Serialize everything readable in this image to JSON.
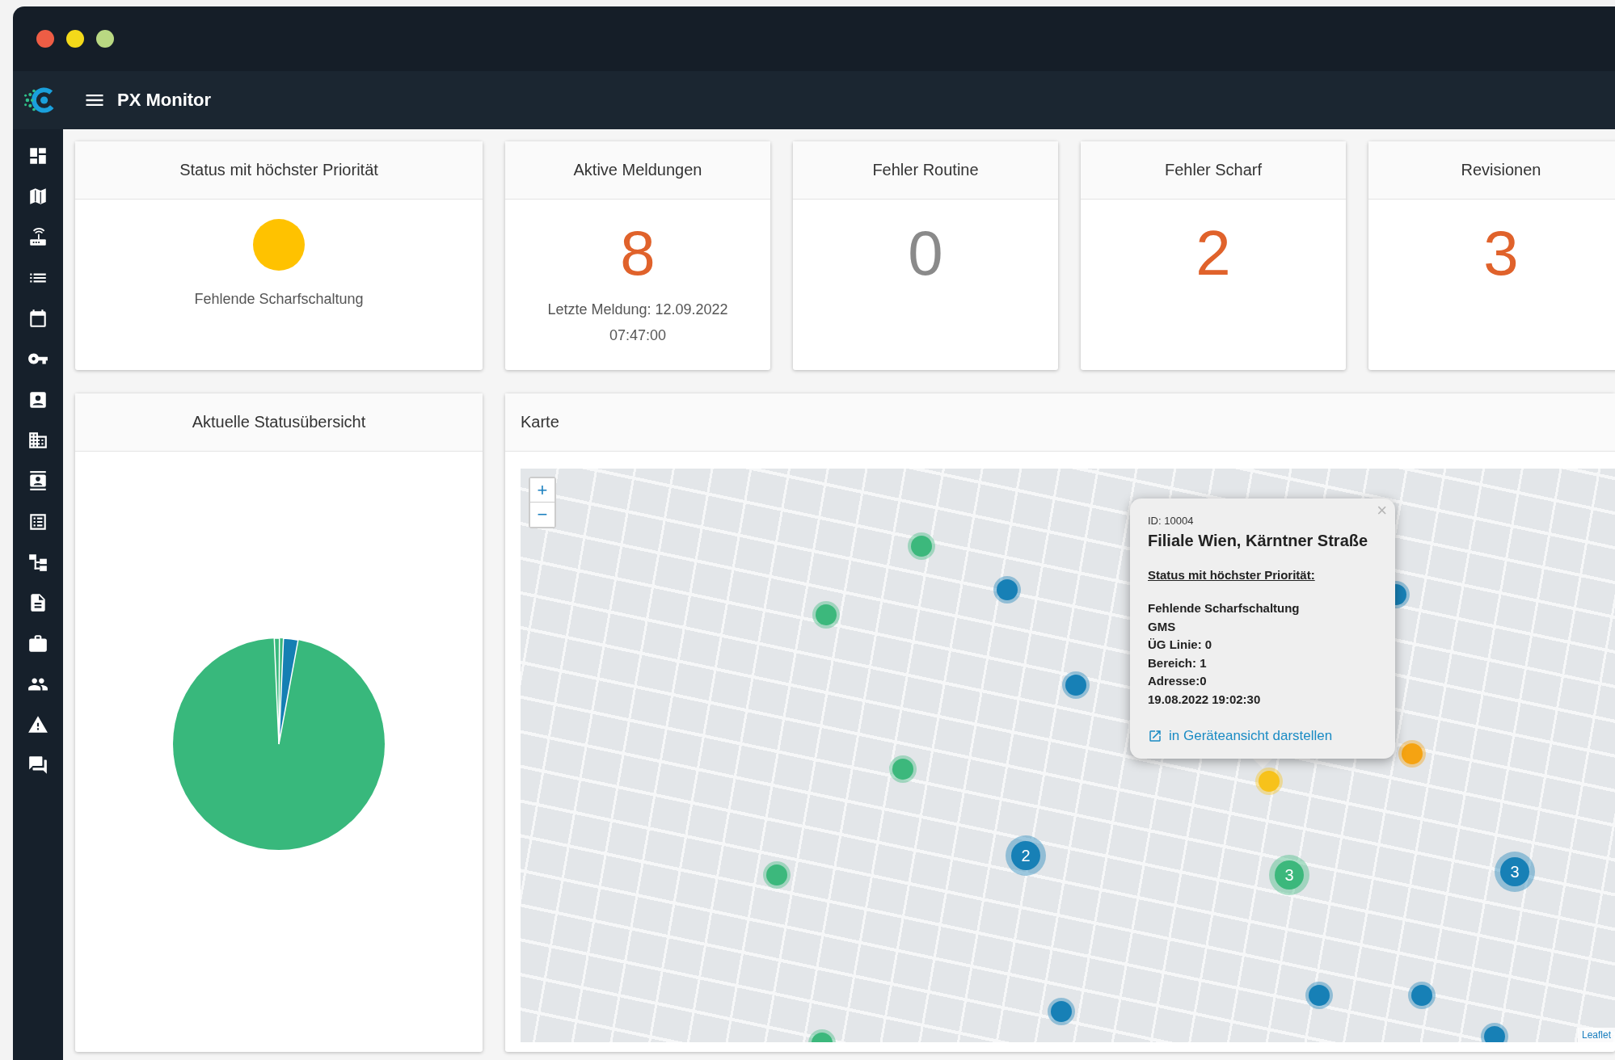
{
  "window": {
    "title": "PX Monitor"
  },
  "kpis": [
    {
      "kind": "status",
      "title": "Status mit höchster Priorität",
      "color": "#ffc200",
      "label": "Fehlende Scharfschaltung"
    },
    {
      "kind": "count",
      "title": "Aktive Meldungen",
      "value": "8",
      "color": "#e0622b",
      "note": "Letzte Meldung: 12.09.2022 07:47:00"
    },
    {
      "kind": "count",
      "title": "Fehler Routine",
      "value": "0",
      "color": "#8a8a8a"
    },
    {
      "kind": "count",
      "title": "Fehler Scharf",
      "value": "2",
      "color": "#e0622b"
    },
    {
      "kind": "count",
      "title": "Revisionen",
      "value": "3",
      "color": "#e0622b"
    }
  ],
  "status_overview": {
    "title": "Aktuelle Statusübersicht"
  },
  "map": {
    "title": "Karte",
    "zoom_in": "+",
    "zoom_out": "−",
    "attribution": "Leaflet",
    "markers": [
      {
        "color": "#3cb87c"
      },
      {
        "color": "#1780b6"
      },
      {
        "color": "#3cb87c"
      },
      {
        "color": "#1780b6"
      },
      {
        "color": "#3cb87c"
      },
      {
        "color": "#3cb87c"
      },
      {
        "color": "#1780b6",
        "count": "2"
      },
      {
        "color": "#3cb87c",
        "count": "3"
      },
      {
        "color": "#1780b6",
        "count": "3"
      },
      {
        "color": "#f7c21b"
      },
      {
        "color": "#f5a312"
      },
      {
        "color": "#1780b6"
      },
      {
        "color": "#1780b6"
      },
      {
        "color": "#1780b6"
      },
      {
        "color": "#1780b6"
      },
      {
        "color": "#3cb87c"
      },
      {
        "color": "#1780b6"
      }
    ],
    "popup": {
      "close": "×",
      "id": "ID: 10004",
      "title": "Filiale Wien, Kärntner Straße",
      "heading": "Status mit höchster Priorität:",
      "lines": [
        "Fehlende Scharfschaltung",
        "GMS",
        "ÜG Linie: 0",
        "Bereich: 1",
        "Adresse:0",
        "19.08.2022 19:02:30"
      ],
      "link": "in Geräteansicht darstellen"
    }
  }
}
